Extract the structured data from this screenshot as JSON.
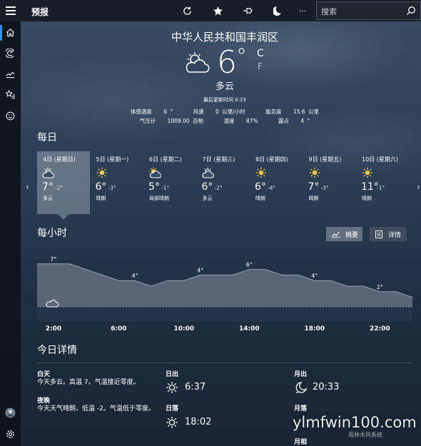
{
  "app": {
    "title": "预报"
  },
  "toolbar": {
    "search_placeholder": "搜索",
    "more_label": "···"
  },
  "current": {
    "location": "中华人民共和国丰润区",
    "temperature": "6",
    "degree": "°",
    "unit_c": "C",
    "unit_f": "F",
    "condition": "多云",
    "icon": "partly-cloudy-icon",
    "updated": "最后更新时间 0:23",
    "details_row1": [
      {
        "label": "体感温度",
        "value": "6 °"
      },
      {
        "label": "风速",
        "value": "0 公里/小时"
      },
      {
        "label": "能见度",
        "value": "15.6 公里"
      }
    ],
    "details_row2": [
      {
        "label": "气压计",
        "value": "1009.00 百帕"
      },
      {
        "label": "湿度",
        "value": "87%"
      },
      {
        "label": "露点",
        "value": "4 °"
      }
    ]
  },
  "daily": {
    "title": "每日",
    "days": [
      {
        "date": "4日 (星期日)",
        "hi": "7°",
        "lo": "-2°",
        "cond": "多云",
        "icon": "partly-cloudy-icon",
        "selected": true
      },
      {
        "date": "5日 (星期一)",
        "hi": "6°",
        "lo": "-3°",
        "cond": "晴朗",
        "icon": "sun-icon",
        "selected": false
      },
      {
        "date": "6日 (星期二)",
        "hi": "5°",
        "lo": "-1°",
        "cond": "局部晴朗",
        "icon": "partly-sunny-icon",
        "selected": false
      },
      {
        "date": "7日 (星期三)",
        "hi": "6°",
        "lo": "-2°",
        "cond": "多云",
        "icon": "partly-cloudy-icon",
        "selected": false
      },
      {
        "date": "8日 (星期四)",
        "hi": "6°",
        "lo": "-4°",
        "cond": "晴朗",
        "icon": "sun-icon",
        "selected": false
      },
      {
        "date": "9日 (星期五)",
        "hi": "7°",
        "lo": "-3°",
        "cond": "晴朗",
        "icon": "sun-icon",
        "selected": false
      },
      {
        "date": "10日 (星期六)",
        "hi": "11°",
        "lo": "-1°",
        "cond": "晴朗",
        "icon": "sun-icon",
        "selected": false
      }
    ]
  },
  "hourly": {
    "title": "每小时",
    "summary_label": "摘要",
    "details_label": "详情"
  },
  "chart_data": {
    "type": "area",
    "x": [
      "1:00",
      "2:00",
      "3:00",
      "4:00",
      "5:00",
      "6:00",
      "7:00",
      "8:00",
      "9:00",
      "10:00",
      "11:00",
      "12:00",
      "13:00",
      "14:00",
      "15:00",
      "16:00",
      "17:00",
      "18:00",
      "19:00",
      "20:00",
      "21:00",
      "22:00",
      "23:00",
      "24:00"
    ],
    "values": [
      7,
      7,
      7,
      6,
      5,
      4,
      4,
      3,
      4,
      4,
      5,
      5,
      5,
      6,
      6,
      5,
      5,
      4,
      4,
      3,
      3,
      2,
      2,
      1
    ],
    "point_labels": [
      {
        "x": "2:00",
        "label": "7°"
      },
      {
        "x": "7:00",
        "label": "4°"
      },
      {
        "x": "11:00",
        "label": "4°"
      },
      {
        "x": "14:00",
        "label": "6°"
      },
      {
        "x": "18:00",
        "label": "4°"
      },
      {
        "x": "22:00",
        "label": "2°"
      }
    ],
    "x_ticks": [
      "2:00",
      "6:00",
      "10:00",
      "14:00",
      "18:00",
      "22:00"
    ],
    "ylim": [
      -2,
      8
    ],
    "icon": "partly-cloudy-icon",
    "title": "",
    "xlabel": "",
    "ylabel": ""
  },
  "today": {
    "title": "今日详情",
    "day_label": "白天",
    "day_text": "今天多云。高温 7。气温接近零度。",
    "night_label": "夜晚",
    "night_text": "今天天气晴朗。低温 -2。气温低于零度。",
    "sunrise_label": "日出",
    "sunrise": "6:37",
    "sunset_label": "日落",
    "sunset": "18:02",
    "moonrise_label": "月出",
    "moonrise": "20:33",
    "moonset_label": "月落",
    "moonphase_label": "月相"
  },
  "watermark": {
    "text": "ylmfwin100.com",
    "sub": "雨林木风系统"
  },
  "colors": {
    "accent": "#3b8de0",
    "chart_fill": "#7b8594"
  }
}
